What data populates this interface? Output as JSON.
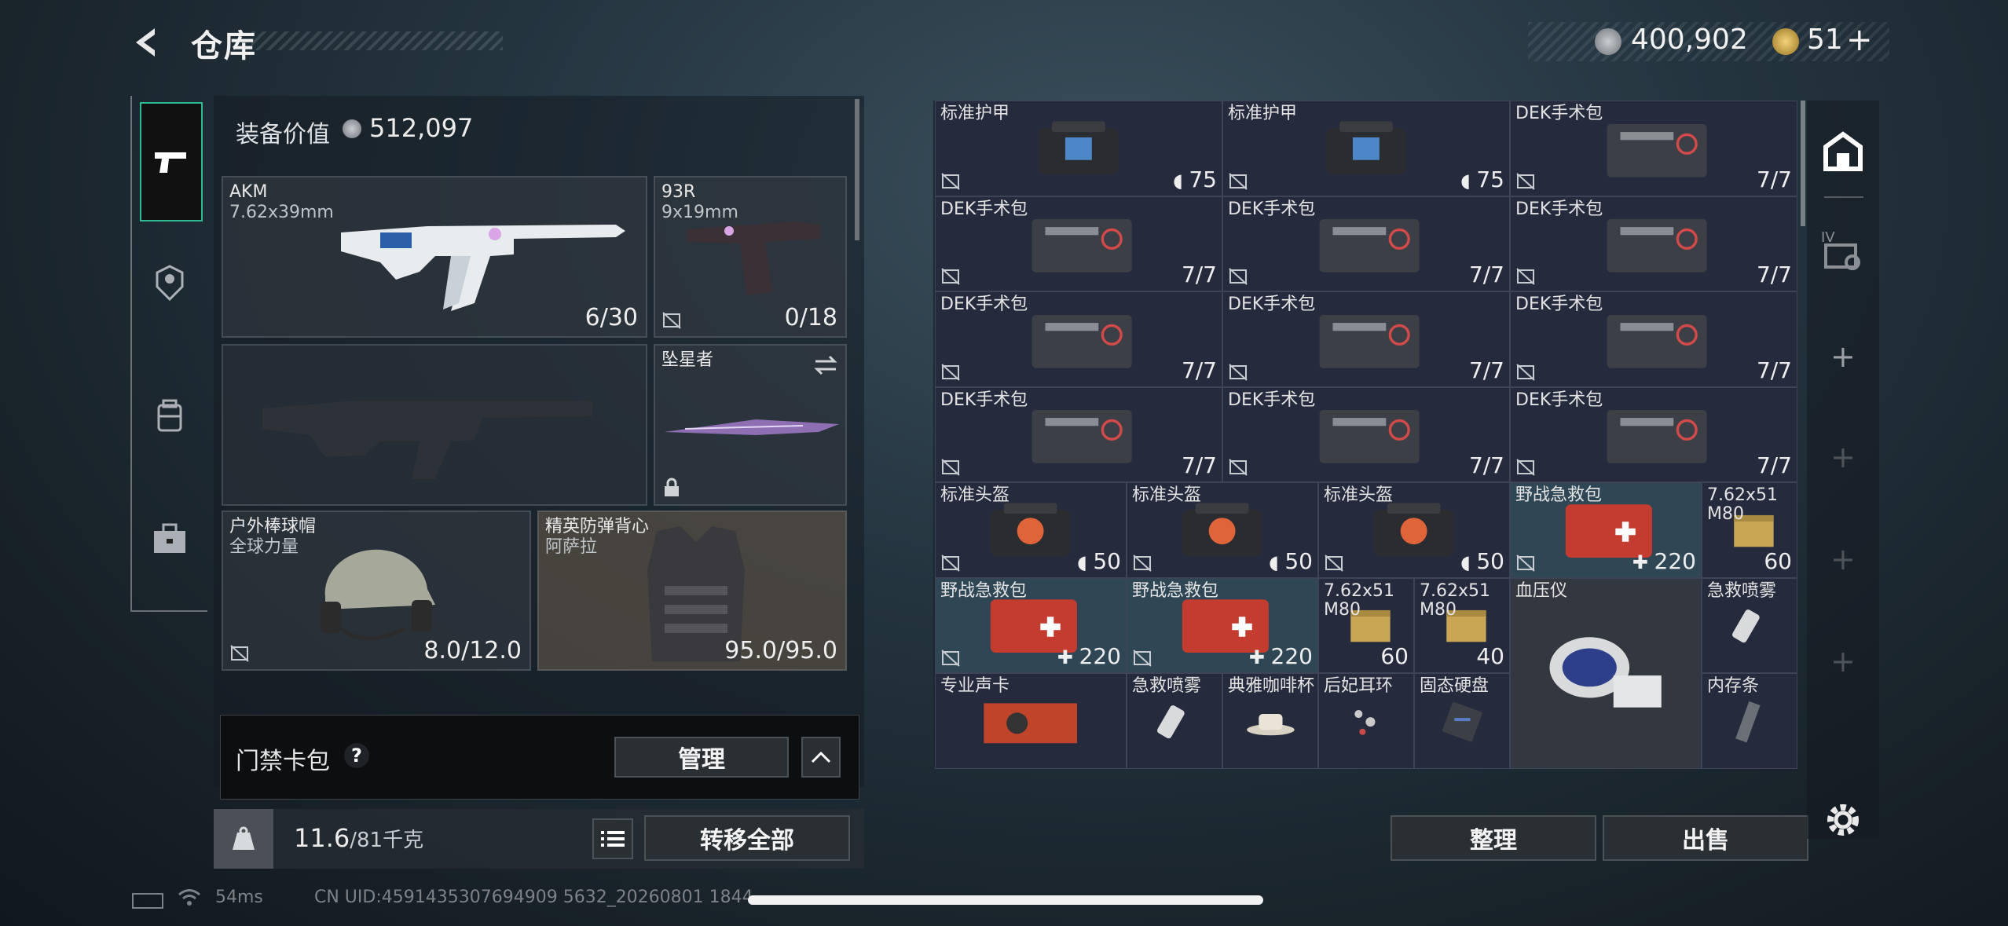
{
  "header": {
    "title": "仓库",
    "back_icon": "back-chevron-icon"
  },
  "currency": {
    "silver": "400,902",
    "gold": "51",
    "add_symbol": "+"
  },
  "nav": [
    {
      "name": "weapon-tab",
      "icon": "pistol-icon"
    },
    {
      "name": "operator-tab",
      "icon": "soldier-icon"
    },
    {
      "name": "backpack-tab",
      "icon": "backpack-icon"
    },
    {
      "name": "case-tab",
      "icon": "briefcase-icon"
    }
  ],
  "equipment": {
    "value_label": "装备价值",
    "value": "512,097",
    "primary": {
      "name": "AKM",
      "caliber": "7.62x39mm",
      "ammo": "6/30"
    },
    "secondary": {
      "name": "93R",
      "caliber": "9x19mm",
      "ammo": "0/18"
    },
    "melee": {
      "name": "坠星者"
    },
    "helmet": {
      "name": "户外棒球帽",
      "sub": "全球力量",
      "durability": "8.0/12.0"
    },
    "armor": {
      "name": "精英防弹背心",
      "sub": "阿萨拉",
      "durability": "95.0/95.0"
    },
    "keycard": {
      "label": "门禁卡包",
      "help": "?",
      "manage": "管理"
    },
    "weight": {
      "current": "11.6",
      "max": "/81千克",
      "transfer_all": "转移全部"
    }
  },
  "storage": {
    "items": [
      {
        "name": "标准护甲",
        "qty": "75",
        "kind": "armor",
        "badge": "shield"
      },
      {
        "name": "标准护甲",
        "qty": "75",
        "kind": "armor",
        "badge": "shield"
      },
      {
        "name": "DEK手术包",
        "qty": "7/7",
        "kind": "kit"
      },
      {
        "name": "DEK手术包",
        "qty": "7/7",
        "kind": "kit"
      },
      {
        "name": "DEK手术包",
        "qty": "7/7",
        "kind": "kit"
      },
      {
        "name": "DEK手术包",
        "qty": "7/7",
        "kind": "kit"
      },
      {
        "name": "DEK手术包",
        "qty": "7/7",
        "kind": "kit"
      },
      {
        "name": "DEK手术包",
        "qty": "7/7",
        "kind": "kit"
      },
      {
        "name": "DEK手术包",
        "qty": "7/7",
        "kind": "kit"
      },
      {
        "name": "DEK手术包",
        "qty": "7/7",
        "kind": "kit"
      },
      {
        "name": "DEK手术包",
        "qty": "7/7",
        "kind": "kit"
      },
      {
        "name": "DEK手术包",
        "qty": "7/7",
        "kind": "kit"
      },
      {
        "name": "标准头盔",
        "qty": "50",
        "kind": "helmetbag",
        "badge": "shield"
      },
      {
        "name": "标准头盔",
        "qty": "50",
        "kind": "helmetbag",
        "badge": "shield"
      },
      {
        "name": "标准头盔",
        "qty": "50",
        "kind": "helmetbag",
        "badge": "shield"
      },
      {
        "name": "野战急救包",
        "qty": "220",
        "kind": "medkit",
        "badge": "plus"
      },
      {
        "name": "7.62x51",
        "sub": "M80",
        "qty": "60",
        "kind": "ammo"
      },
      {
        "name": "野战急救包",
        "qty": "220",
        "kind": "medkit",
        "badge": "plus"
      },
      {
        "name": "野战急救包",
        "qty": "220",
        "kind": "medkit",
        "badge": "plus"
      },
      {
        "name": "7.62x51",
        "sub": "M80",
        "qty": "60",
        "kind": "ammo"
      },
      {
        "name": "7.62x51",
        "sub": "M80",
        "qty": "40",
        "kind": "ammo"
      },
      {
        "name": "血压仪",
        "qty": "",
        "kind": "bp"
      },
      {
        "name": "急救喷雾",
        "qty": "",
        "kind": "spray"
      },
      {
        "name": "专业声卡",
        "qty": "",
        "kind": "card"
      },
      {
        "name": "急救喷雾",
        "qty": "",
        "kind": "spray"
      },
      {
        "name": "典雅咖啡杯",
        "qty": "",
        "kind": "cup"
      },
      {
        "name": "后妃耳环",
        "qty": "",
        "kind": "earring"
      },
      {
        "name": "固态硬盘",
        "qty": "",
        "kind": "ssd"
      },
      {
        "name": "内存条",
        "qty": "",
        "kind": "ram"
      }
    ],
    "sort_button": "整理",
    "sell_button": "出售"
  },
  "side_tools": {
    "roman": "IV"
  },
  "status": {
    "ping": "54ms",
    "uid": "CN UID:4591435307694909 5632_20260801 1844"
  }
}
